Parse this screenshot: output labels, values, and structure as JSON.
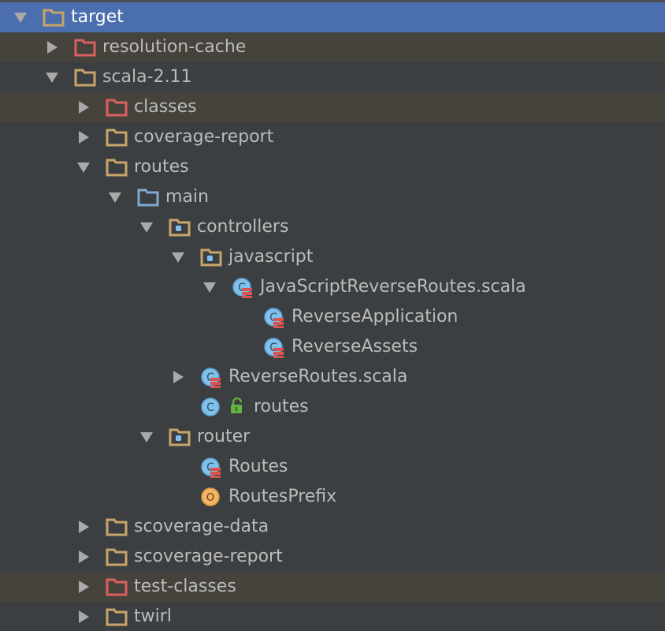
{
  "colors": {
    "background": "#3c3f41",
    "selection": "#4b6eaf",
    "excluded_row": "#45433c",
    "folder": "#c7a56a",
    "excluded_folder": "#d9605f",
    "source_folder": "#7fa9d1",
    "class_icon": "#7fc1eb",
    "object_icon": "#f5b463",
    "text": "#bbbbbb"
  },
  "tree": [
    {
      "label": "target",
      "depth": 0,
      "expander": "expanded",
      "icon": "folder-icon",
      "state": "selected"
    },
    {
      "label": "resolution-cache",
      "depth": 1,
      "expander": "collapsed",
      "icon": "excluded-folder-icon",
      "state": "excluded"
    },
    {
      "label": "scala-2.11",
      "depth": 1,
      "expander": "expanded",
      "icon": "folder-icon",
      "state": "normal"
    },
    {
      "label": "classes",
      "depth": 2,
      "expander": "collapsed",
      "icon": "excluded-folder-icon",
      "state": "excluded"
    },
    {
      "label": "coverage-report",
      "depth": 2,
      "expander": "collapsed",
      "icon": "folder-icon",
      "state": "normal"
    },
    {
      "label": "routes",
      "depth": 2,
      "expander": "expanded",
      "icon": "folder-icon",
      "state": "normal"
    },
    {
      "label": "main",
      "depth": 3,
      "expander": "expanded",
      "icon": "source-folder-icon",
      "state": "normal"
    },
    {
      "label": "controllers",
      "depth": 4,
      "expander": "expanded",
      "icon": "package-icon",
      "state": "normal"
    },
    {
      "label": "javascript",
      "depth": 5,
      "expander": "expanded",
      "icon": "package-icon",
      "state": "normal"
    },
    {
      "label": "JavaScriptReverseRoutes.scala",
      "depth": 6,
      "expander": "expanded",
      "icon": "scala-file-icon",
      "state": "normal"
    },
    {
      "label": "ReverseApplication",
      "depth": 7,
      "expander": "none",
      "icon": "scala-class-icon",
      "state": "normal"
    },
    {
      "label": "ReverseAssets",
      "depth": 7,
      "expander": "none",
      "icon": "scala-class-icon",
      "state": "normal"
    },
    {
      "label": "ReverseRoutes.scala",
      "depth": 5,
      "expander": "collapsed",
      "icon": "scala-file-icon",
      "state": "normal"
    },
    {
      "label": "routes",
      "depth": 5,
      "expander": "none",
      "icon": "class-icon",
      "badge": "unlock-icon",
      "state": "normal"
    },
    {
      "label": "router",
      "depth": 4,
      "expander": "expanded",
      "icon": "package-icon",
      "state": "normal"
    },
    {
      "label": "Routes",
      "depth": 5,
      "expander": "none",
      "icon": "scala-class-icon",
      "state": "normal"
    },
    {
      "label": "RoutesPrefix",
      "depth": 5,
      "expander": "none",
      "icon": "object-icon",
      "state": "normal"
    },
    {
      "label": "scoverage-data",
      "depth": 2,
      "expander": "collapsed",
      "icon": "folder-icon",
      "state": "normal"
    },
    {
      "label": "scoverage-report",
      "depth": 2,
      "expander": "collapsed",
      "icon": "folder-icon",
      "state": "normal"
    },
    {
      "label": "test-classes",
      "depth": 2,
      "expander": "collapsed",
      "icon": "excluded-folder-icon",
      "state": "excluded"
    },
    {
      "label": "twirl",
      "depth": 2,
      "expander": "collapsed",
      "icon": "folder-icon",
      "state": "normal"
    }
  ]
}
